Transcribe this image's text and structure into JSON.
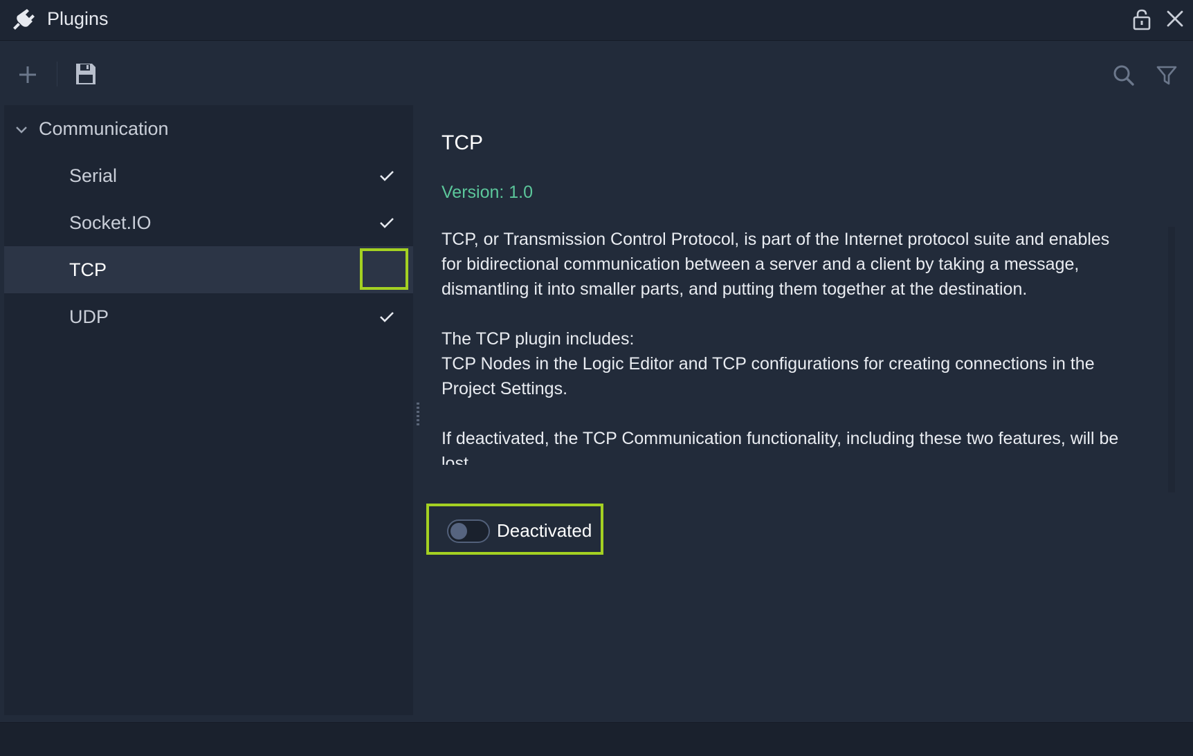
{
  "window": {
    "title": "Plugins"
  },
  "icons": {
    "app": "plug-icon",
    "lock": "lock-icon",
    "close": "close-icon",
    "add": "plus-icon",
    "save": "save-icon",
    "search": "search-icon",
    "filter": "filter-icon"
  },
  "sidebar": {
    "group": {
      "label": "Communication",
      "expanded": true
    },
    "items": [
      {
        "label": "Serial",
        "checked": true
      },
      {
        "label": "Socket.IO",
        "checked": true
      },
      {
        "label": "TCP",
        "checked": false
      },
      {
        "label": "UDP",
        "checked": true
      }
    ]
  },
  "details": {
    "title": "TCP",
    "version": "Version: 1.0",
    "paragraphs": [
      "TCP, or Transmission Control Protocol, is part of the Internet protocol suite and enables for bidirectional communication between a server and a client by taking a message, dismantling it into smaller parts, and putting them together at the destination.",
      "The TCP plugin includes:",
      "TCP Nodes in the Logic Editor and TCP configurations for creating connections in the Project Settings.",
      "If deactivated, the TCP Communication functionality, including these two features, will be lost."
    ],
    "toggle": {
      "label": "Deactivated",
      "on": false
    }
  },
  "colors": {
    "accent_highlight": "#a4d122",
    "version_text": "#5cc79b",
    "panel_bg": "#222b3a",
    "sidebar_bg": "#1d2533"
  }
}
